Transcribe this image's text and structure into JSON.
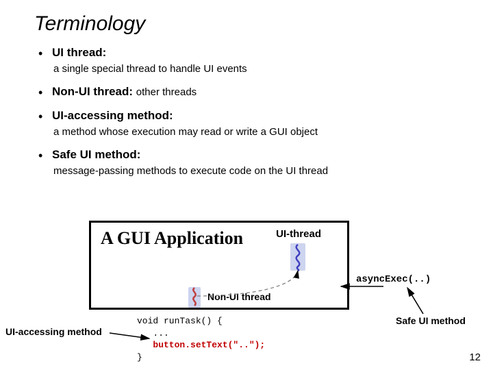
{
  "title": "Terminology",
  "bullets": [
    {
      "term": "UI thread:",
      "sub": "a single special thread to handle UI events",
      "inline": false
    },
    {
      "term": "Non-UI thread:",
      "sub": "other threads",
      "inline": true
    },
    {
      "term": "UI-accessing method:",
      "sub": "a method whose execution may read or write a GUI object",
      "inline": false
    },
    {
      "term": "Safe UI method:",
      "sub": "message-passing methods to execute code on the UI thread",
      "inline": false
    }
  ],
  "diagram": {
    "app_title": "A GUI Application",
    "ui_thread_label": "UI-thread",
    "nonui_thread_label": "Non-UI thread"
  },
  "async_label": "asyncExec(..)",
  "safe_label": "Safe UI method",
  "ui_acc_label": "UI-accessing method",
  "code": {
    "l1": "void runTask() {",
    "l2": "   ...",
    "l3_a": "   ",
    "l3_b": "button.setText(\"..\");",
    "l4": "}"
  },
  "pagenum": "12"
}
